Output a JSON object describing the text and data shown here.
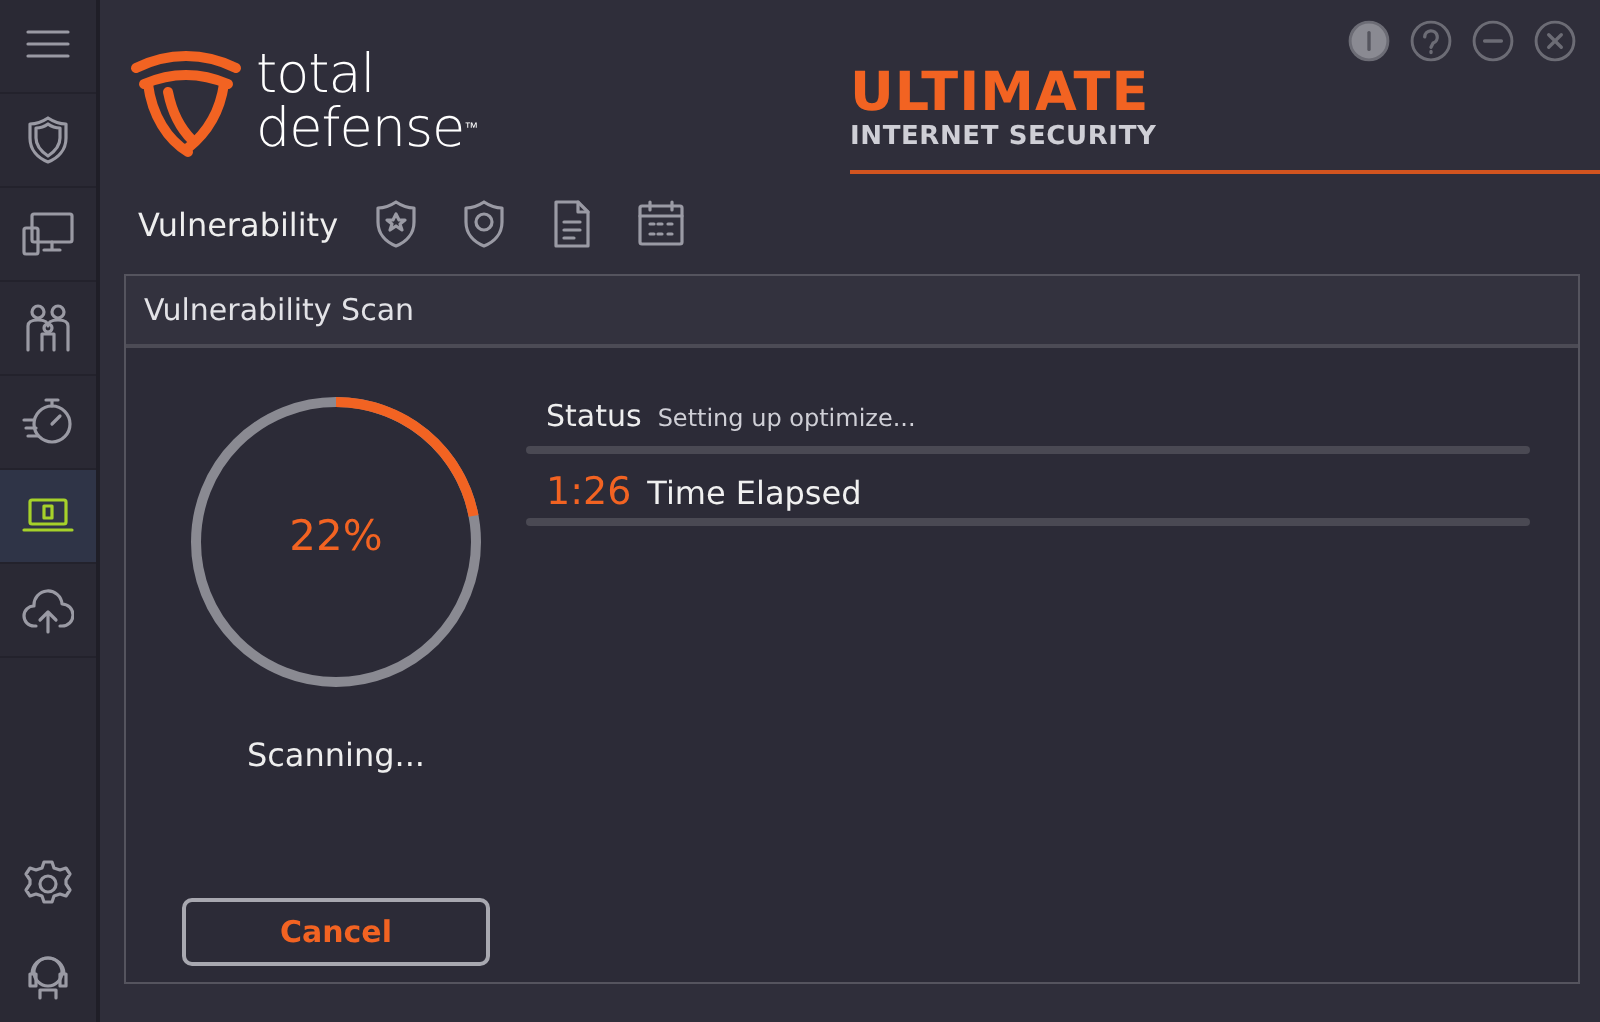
{
  "sidebar": {
    "items": [
      {
        "selected": false
      },
      {
        "selected": false
      },
      {
        "selected": false
      },
      {
        "selected": false
      },
      {
        "selected": false
      },
      {
        "selected": true
      },
      {
        "selected": false
      }
    ],
    "footer_items": [
      {
        "selected": false
      },
      {
        "selected": false
      }
    ]
  },
  "logo": {
    "line_1": "total",
    "line_2": "defense",
    "mark": "™"
  },
  "brand": {
    "title": "ULTIMATE",
    "subtitle": "INTERNET SECURITY"
  },
  "toolbar": {
    "title": "Vulnerability"
  },
  "panel": {
    "title": "Vulnerability Scan",
    "progress": {
      "level": 0.22,
      "reading": "22%",
      "caption": "Scanning..."
    },
    "status": {
      "label": "Status",
      "value": "Setting up optimize..."
    },
    "elapsed": {
      "time": "1:26",
      "label": "Time Elapsed"
    },
    "cancel_button": "Cancel"
  }
}
